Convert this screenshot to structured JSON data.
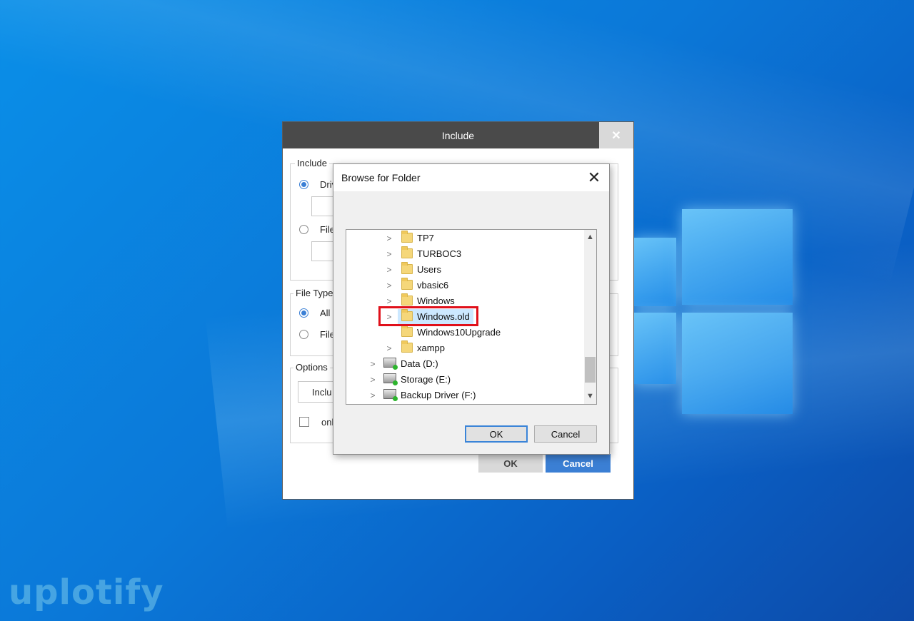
{
  "watermark": "uplotify",
  "include_dialog": {
    "title": "Include",
    "close": "✕",
    "include_group": {
      "label": "Include",
      "radio_drive": "Driv",
      "radio_file": "File"
    },
    "filetype_group": {
      "label": "File Type",
      "radio_all": "All f",
      "radio_file": "File"
    },
    "options_group": {
      "label": "Options",
      "dropdown_value": "Inclu",
      "checkbox_label": "only"
    },
    "ok_label": "OK",
    "cancel_label": "Cancel",
    "colors": {
      "titlebar": "#4a4a4a",
      "cancel_bg": "#3b7fd4",
      "ok_bg": "#d9d9d9"
    }
  },
  "browse_dialog": {
    "title": "Browse for Folder",
    "close": "✕",
    "tree_items": [
      {
        "label": "TP7",
        "type": "folder"
      },
      {
        "label": "TURBOC3",
        "type": "folder"
      },
      {
        "label": "Users",
        "type": "folder"
      },
      {
        "label": "vbasic6",
        "type": "folder"
      },
      {
        "label": "Windows",
        "type": "folder"
      },
      {
        "label": "Windows.old",
        "type": "folder",
        "selected": true
      },
      {
        "label": "Windows10Upgrade",
        "type": "folder"
      },
      {
        "label": "xampp",
        "type": "folder"
      },
      {
        "label": "Data (D:)",
        "type": "drive"
      },
      {
        "label": "Storage (E:)",
        "type": "drive"
      },
      {
        "label": "Backup Driver (F:)",
        "type": "drive"
      }
    ],
    "ok_label": "OK",
    "cancel_label": "Cancel",
    "highlight_color": "#e0101a"
  }
}
